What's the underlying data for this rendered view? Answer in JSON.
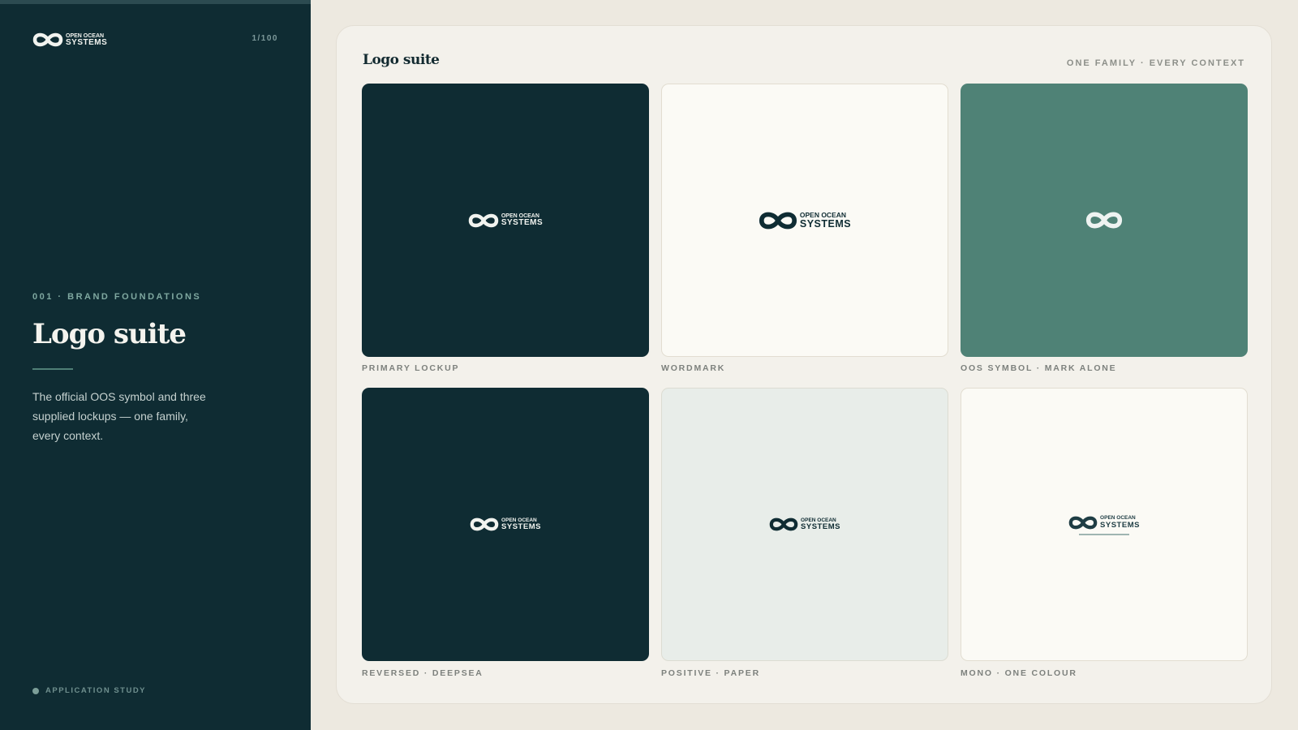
{
  "sidebar": {
    "brand": {
      "line1": "OPEN OCEAN",
      "line2": "SYSTEMS"
    },
    "page_counter": "1/100",
    "eyebrow": "001 · BRAND FOUNDATIONS",
    "title": "Logo suite",
    "description": "The official OOS symbol and three supplied lockups — one family, every context.",
    "footer_tag": "APPLICATION STUDY"
  },
  "card": {
    "title": "Logo suite",
    "subtitle": "ONE FAMILY · EVERY CONTEXT",
    "tiles": [
      {
        "label": "PRIMARY LOCKUP",
        "background": "#0f2c33",
        "logo_color": "#f1f3ef",
        "line1": "OPEN OCEAN",
        "line2": "SYSTEMS"
      },
      {
        "label": "WORDMARK",
        "background": "#fbfaf5",
        "logo_color": "#0f2c33",
        "line1": "OPEN OCEAN",
        "line2": "SYSTEMS"
      },
      {
        "label": "OOS SYMBOL · MARK ALONE",
        "background": "#4f8276",
        "logo_color": "#eef3f1"
      },
      {
        "label": "REVERSED · DEEPSEA",
        "background": "#0f2c33",
        "logo_color": "#f1f3ef",
        "line1": "OPEN OCEAN",
        "line2": "SYSTEMS"
      },
      {
        "label": "POSITIVE · PAPER",
        "background": "#e8ede9",
        "logo_color": "#0f2c33",
        "line1": "OPEN OCEAN",
        "line2": "SYSTEMS"
      },
      {
        "label": "MONO · ONE COLOUR",
        "background": "#fbfaf5",
        "logo_color": "#1f3d44",
        "line1": "OPEN OCEAN",
        "line2": "SYSTEMS"
      }
    ]
  },
  "colors": {
    "deepsea": "#0f2c33",
    "paper": "#fbfaf5",
    "sea_green": "#4f8276",
    "mist": "#e8ede9",
    "accent_teal": "#7fa8a0"
  }
}
